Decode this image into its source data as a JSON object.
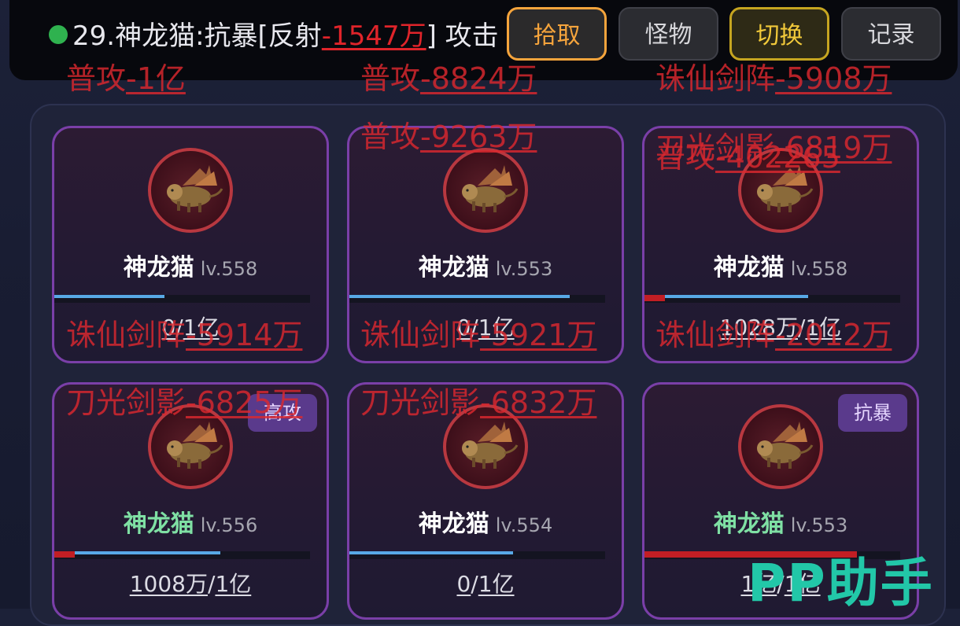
{
  "log": {
    "prefix": "29.神龙猫:抗暴[反射",
    "damage": "-1547万",
    "suffix": "] 攻击"
  },
  "buttons": {
    "pick": "拾取",
    "monster": "怪物",
    "switch": "切换",
    "record": "记录"
  },
  "cards": [
    {
      "name": "神龙猫",
      "level": "lv.558",
      "hp_current": "0",
      "hp_max": "1亿",
      "hp_fraction": 0.43,
      "damage_fraction": 0,
      "name_color": "white",
      "tag": ""
    },
    {
      "name": "神龙猫",
      "level": "lv.553",
      "hp_current": "0",
      "hp_max": "1亿",
      "hp_fraction": 0.86,
      "damage_fraction": 0,
      "name_color": "white",
      "tag": ""
    },
    {
      "name": "神龙猫",
      "level": "lv.558",
      "hp_current": "1028万",
      "hp_max": "1亿",
      "hp_fraction": 0.64,
      "damage_fraction": 0.08,
      "name_color": "white",
      "tag": ""
    },
    {
      "name": "神龙猫",
      "level": "lv.556",
      "hp_current": "1008万",
      "hp_max": "1亿",
      "hp_fraction": 0.65,
      "damage_fraction": 0.08,
      "name_color": "green",
      "tag": "高攻"
    },
    {
      "name": "神龙猫",
      "level": "lv.554",
      "hp_current": "0",
      "hp_max": "1亿",
      "hp_fraction": 0.64,
      "damage_fraction": 0,
      "name_color": "white",
      "tag": ""
    },
    {
      "name": "神龙猫",
      "level": "lv.553",
      "hp_current": "1亿",
      "hp_max": "1亿",
      "hp_fraction": 0.79,
      "damage_fraction": 0.83,
      "name_color": "green",
      "tag": "抗暴"
    }
  ],
  "floating_damage": [
    {
      "skill": "普攻",
      "value": "-1亿"
    },
    {
      "skill": "普攻",
      "value": "-8824万"
    },
    {
      "skill": "诛仙剑阵",
      "value": "-5908万"
    },
    {
      "skill": "普攻",
      "value": "-9263万"
    },
    {
      "skill": "刀光剑影",
      "value": "-6819万"
    },
    {
      "skill": "普攻",
      "value": "-402265"
    },
    {
      "skill": "诛仙剑阵",
      "value": "-5914万"
    },
    {
      "skill": "诛仙剑阵",
      "value": "-5921万"
    },
    {
      "skill": "诛仙剑阵",
      "value": "-2012万"
    },
    {
      "skill": "刀光剑影",
      "value": "-6825万"
    },
    {
      "skill": "刀光剑影",
      "value": "-6832万"
    }
  ],
  "watermark": "PP助手",
  "colors": {
    "accent_orange": "#f5a43c",
    "accent_gold": "#f0c83a",
    "damage_red": "#e0242a",
    "card_border": "#7a3fa8",
    "hp_blue": "#58a9e6",
    "green_name": "#7fe0a4"
  }
}
